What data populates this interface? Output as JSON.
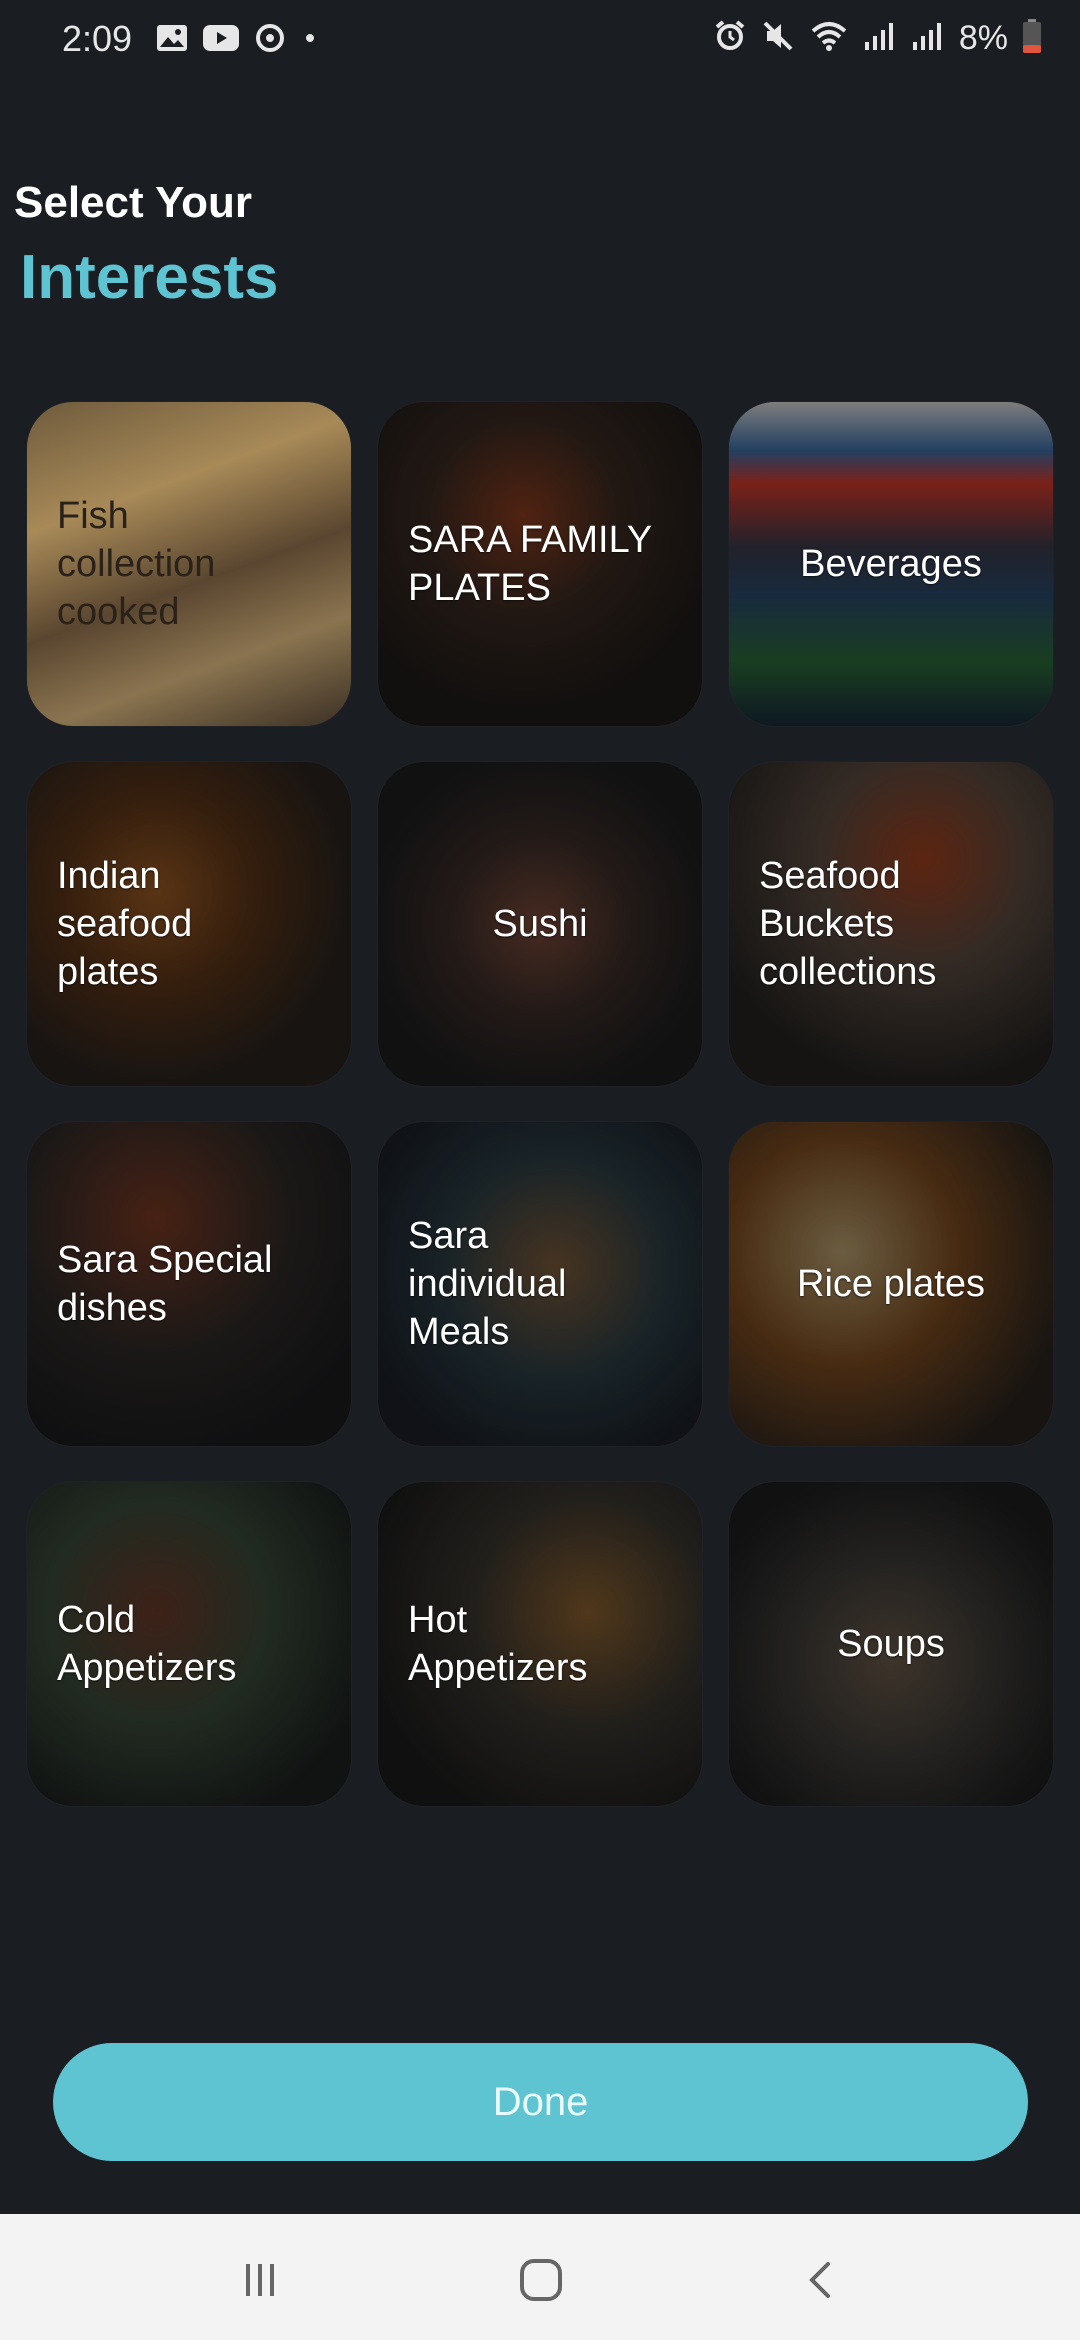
{
  "status_bar": {
    "time": "2:09",
    "battery_percent": "8%",
    "left_icons": [
      "image-icon",
      "youtube-icon",
      "sync-icon",
      "dot-icon"
    ],
    "right_icons": [
      "alarm-icon",
      "mute-icon",
      "wifi-icon",
      "signal-icon",
      "signal-icon",
      "battery-icon"
    ],
    "battery_color": "#e0553b"
  },
  "header": {
    "line1": "Select Your",
    "line2": "Interests",
    "accent_color": "#5ec4d1"
  },
  "interests": [
    {
      "label": "Fish\ncollection\ncooked",
      "style": "dark"
    },
    {
      "label": "SARA FAMILY\nPLATES",
      "style": "left"
    },
    {
      "label": "Beverages",
      "style": "center"
    },
    {
      "label": "Indian\nseafood\nplates",
      "style": "left"
    },
    {
      "label": "Sushi",
      "style": "center"
    },
    {
      "label": "Seafood\nBuckets\ncollections",
      "style": "left"
    },
    {
      "label": "Sara Special\ndishes",
      "style": "left"
    },
    {
      "label": "Sara\nindividual\nMeals",
      "style": "left"
    },
    {
      "label": "Rice plates",
      "style": "center"
    },
    {
      "label": "Cold\nAppetizers",
      "style": "left"
    },
    {
      "label": "Hot\nAppetizers",
      "style": "left"
    },
    {
      "label": "Soups",
      "style": "center"
    }
  ],
  "done_button": {
    "label": "Done"
  },
  "nav_bar": {
    "icons": [
      "recent-apps-icon",
      "home-icon",
      "back-icon"
    ]
  }
}
